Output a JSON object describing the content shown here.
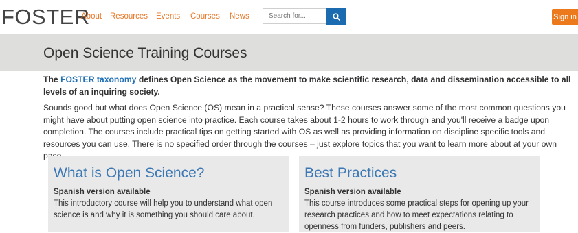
{
  "nav": {
    "logo": "FOSTER",
    "links": [
      "About",
      "Resources",
      "Events",
      "Courses",
      "News"
    ],
    "search_placeholder": "Search for...",
    "signin": "Sign in"
  },
  "page": {
    "title": "Open Science Training Courses",
    "intro_prefix": "The ",
    "intro_link": "FOSTER taxonomy",
    "intro_suffix": " defines Open Science as the movement to make scientific research, data and dissemination accessible to all levels of an inquiring society.",
    "body": "Sounds good but what does Open Science (OS) mean in a practical sense? These courses answer some of the most common questions you might have about putting open science into practice. Each course takes about 1-2 hours to work through and you'll receive a badge upon completion. The courses include practical tips on getting started with OS as well as providing information on discipline specific tools and resources you can use. There is no specified order through the courses – just explore topics that you want to learn more about at your own pace."
  },
  "cards": [
    {
      "title": "What is Open Science?",
      "subtitle": "Spanish version available",
      "text": "This introductory course will help you to understand what open science is and why it is something you should care about."
    },
    {
      "title": "Best Practices",
      "subtitle": "Spanish version available",
      "text": "This course introduces some practical steps for opening up your research practices and how to meet  expectations relating to openness from funders, publishers and peers."
    }
  ],
  "colors": {
    "accent": "#ec7a1c",
    "link": "#1f6fb5",
    "search_button": "#1b6bb0",
    "band": "#dededc"
  }
}
